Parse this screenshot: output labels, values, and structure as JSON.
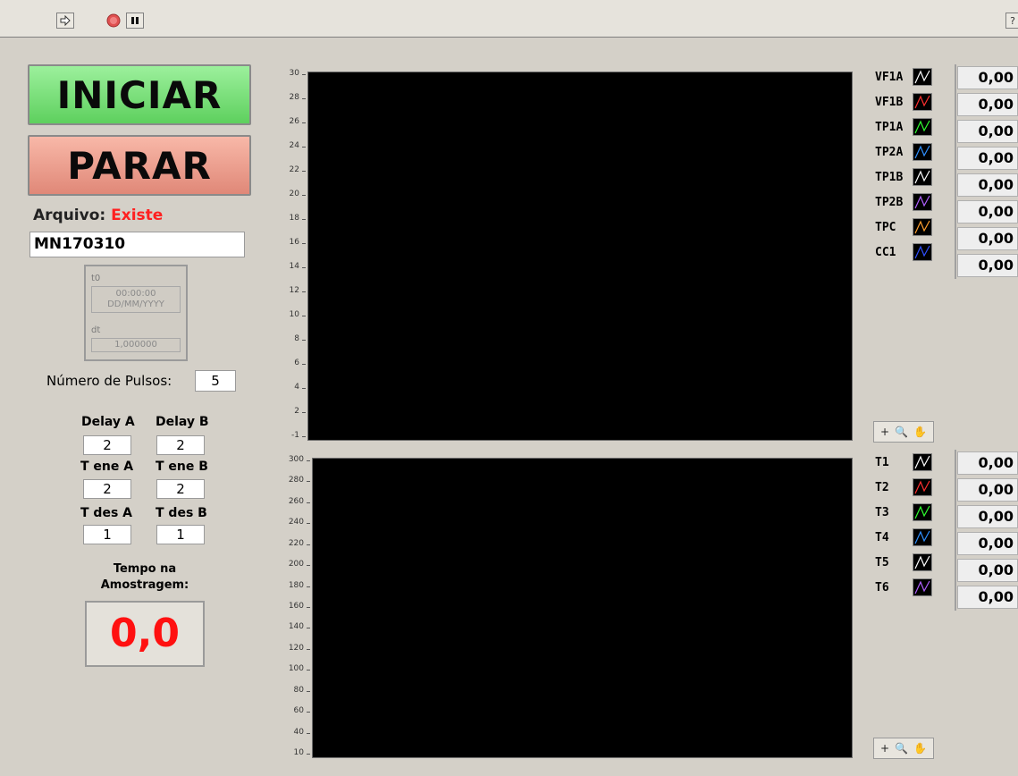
{
  "toolbar": {
    "run_icon": "run-arrow-icon",
    "abort_icon": "abort-icon",
    "pause_icon": "pause-icon",
    "help_icon": "help-icon",
    "help_label": "?"
  },
  "controls": {
    "start_label": "INICIAR",
    "stop_label": "PARAR",
    "file_label": "Arquivo:",
    "file_status": "Existe",
    "file_name": "MN170310",
    "t0_label": "t0",
    "t0_time": "00:00:00",
    "t0_date": "DD/MM/YYYY",
    "dt_label": "dt",
    "dt_value": "1,000000",
    "pulses_label": "Número de Pulsos:",
    "pulses_value": "5",
    "delay_a_label": "Delay A",
    "delay_b_label": "Delay B",
    "delay_a": "2",
    "delay_b": "2",
    "tene_a_label": "T ene A",
    "tene_b_label": "T ene B",
    "tene_a": "2",
    "tene_b": "2",
    "tdes_a_label": "T des A",
    "tdes_b_label": "T des B",
    "tdes_a": "1",
    "tdes_b": "1",
    "sample_time_label_1": "Tempo na",
    "sample_time_label_2": "Amostragem:",
    "sample_time_value": "0,0"
  },
  "colors": {
    "start_button": "#6ee06e",
    "stop_button": "#f0a090",
    "file_status": "#ff2020",
    "sample_time": "#ff1010"
  },
  "chart_data": [
    {
      "type": "line",
      "title": "",
      "xlabel": "",
      "ylabel": "",
      "ylim": [
        -1,
        30
      ],
      "yticks": [
        "30",
        "28",
        "26",
        "24",
        "22",
        "20",
        "18",
        "16",
        "14",
        "12",
        "10",
        "8",
        "6",
        "4",
        "2",
        "-1"
      ],
      "series": [
        {
          "name": "VF1A",
          "color": "#ffffff",
          "values": [],
          "readout": "0,00"
        },
        {
          "name": "VF1B",
          "color": "#ff3030",
          "values": [],
          "readout": "0,00"
        },
        {
          "name": "TP1A",
          "color": "#30ff30",
          "values": [],
          "readout": "0,00"
        },
        {
          "name": "TP2A",
          "color": "#3090ff",
          "values": [],
          "readout": "0,00"
        },
        {
          "name": "TP1B",
          "color": "#ffffff",
          "values": [],
          "readout": "0,00"
        },
        {
          "name": "TP2B",
          "color": "#b060ff",
          "values": [],
          "readout": "0,00"
        },
        {
          "name": "TPC",
          "color": "#ffa030",
          "values": [],
          "readout": "0,00"
        },
        {
          "name": "CC1",
          "color": "#3050ff",
          "values": [],
          "readout": "0,00"
        }
      ]
    },
    {
      "type": "line",
      "title": "",
      "xlabel": "",
      "ylabel": "",
      "ylim": [
        10,
        300
      ],
      "yticks": [
        "300",
        "280",
        "260",
        "240",
        "220",
        "200",
        "180",
        "160",
        "140",
        "120",
        "100",
        "80",
        "60",
        "40",
        "10"
      ],
      "series": [
        {
          "name": "T1",
          "color": "#ffffff",
          "values": [],
          "readout": "0,00"
        },
        {
          "name": "T2",
          "color": "#ff3030",
          "values": [],
          "readout": "0,00"
        },
        {
          "name": "T3",
          "color": "#30ff30",
          "values": [],
          "readout": "0,00"
        },
        {
          "name": "T4",
          "color": "#3090ff",
          "values": [],
          "readout": "0,00"
        },
        {
          "name": "T5",
          "color": "#ffffff",
          "values": [],
          "readout": "0,00"
        },
        {
          "name": "T6",
          "color": "#b060ff",
          "values": [],
          "readout": "0,00"
        }
      ]
    }
  ]
}
